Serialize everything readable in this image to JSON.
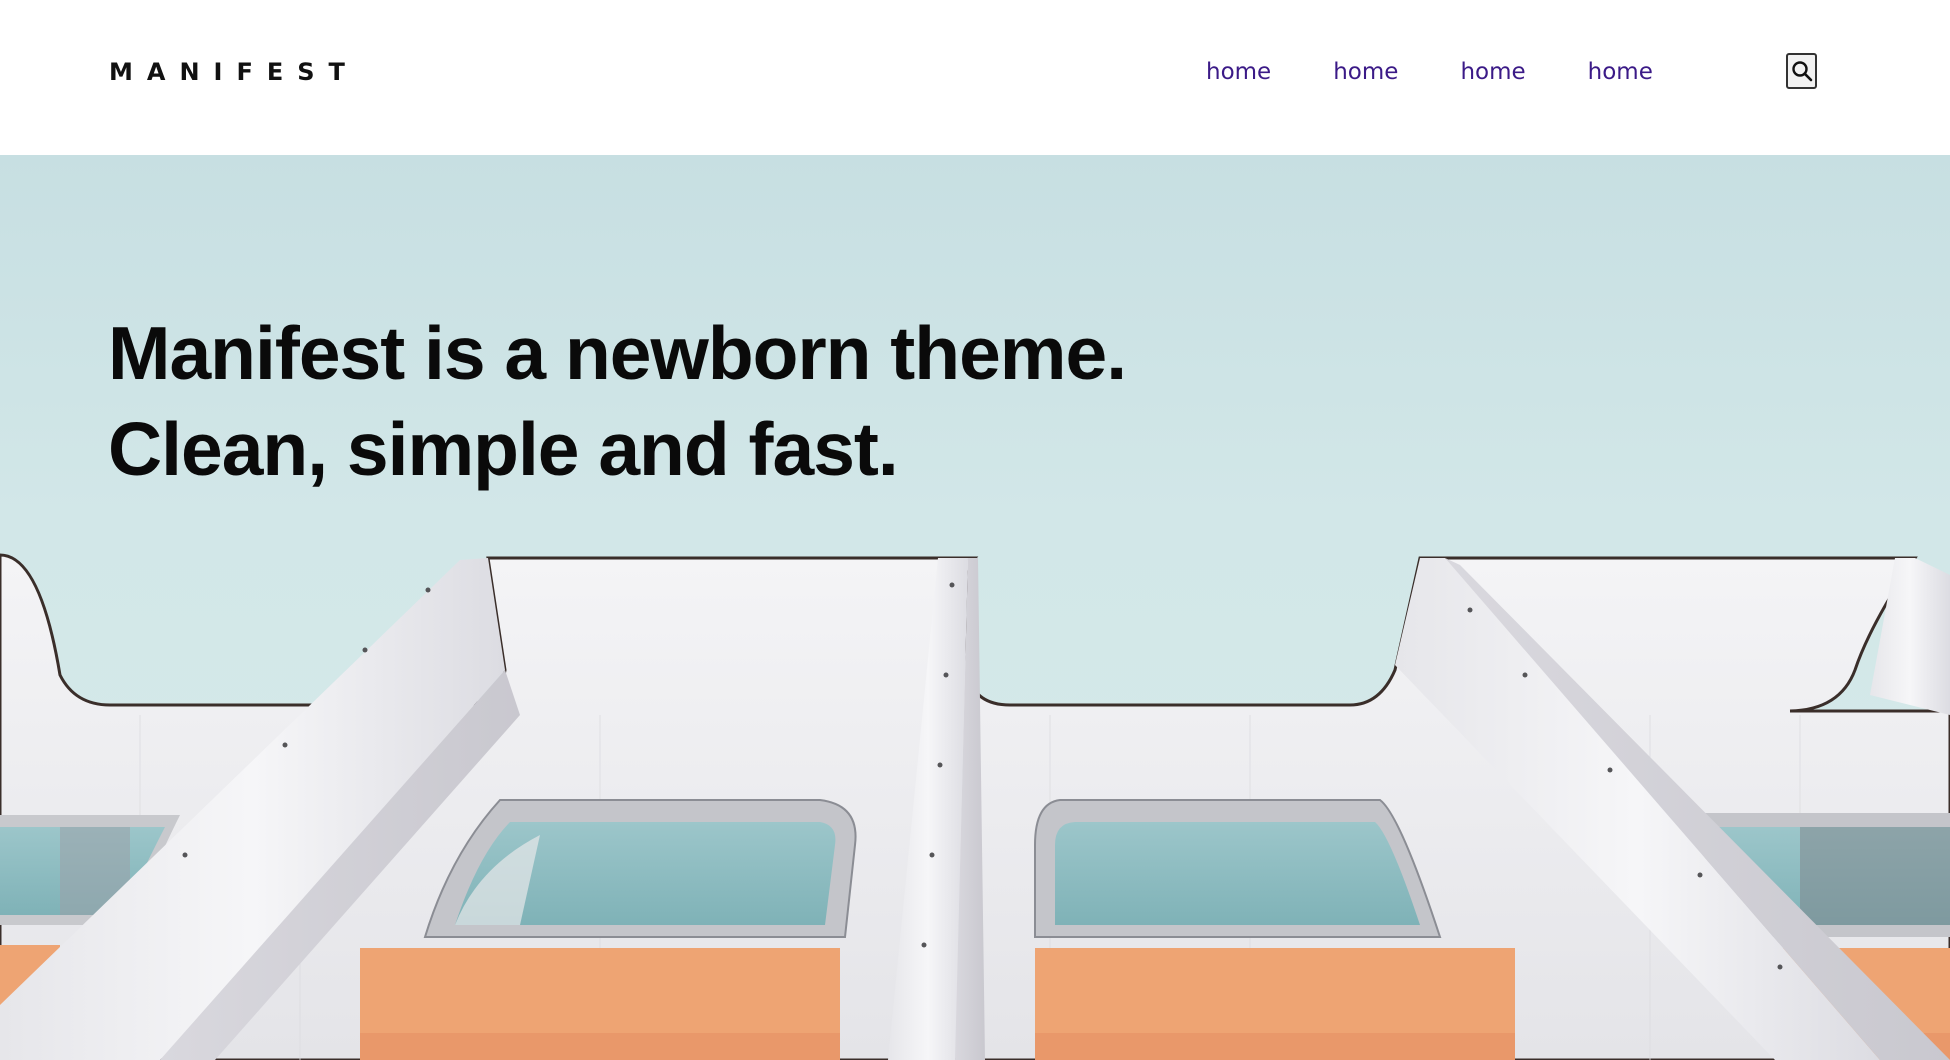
{
  "header": {
    "brand": "MANIFEST",
    "nav": [
      {
        "label": "home"
      },
      {
        "label": "home"
      },
      {
        "label": "home"
      },
      {
        "label": "home"
      }
    ],
    "search_icon": "search-icon"
  },
  "hero": {
    "headline_line1": "Manifest is a newborn theme.",
    "headline_line2": "Clean, simple and fast.",
    "image": "building-facade-photo"
  },
  "colors": {
    "nav_link": "#3b1a87",
    "sky": "#d2e7e8",
    "panel_orange": "#eea473",
    "building_white": "#eeeef0",
    "window_glass": "#8fbfc4"
  }
}
